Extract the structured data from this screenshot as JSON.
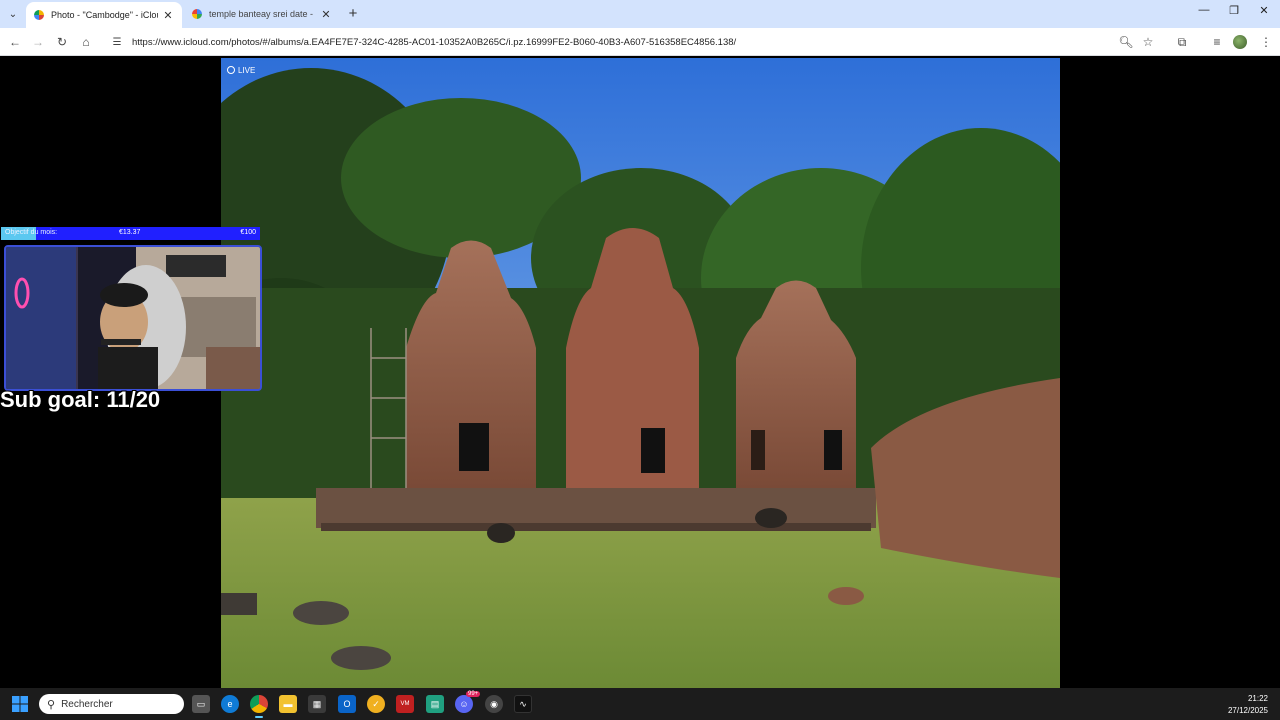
{
  "browser": {
    "tabs": [
      {
        "label": "Photo - \"Cambodge\" - iCloud P",
        "active": true
      },
      {
        "label": "temple banteay srei date - Rech",
        "active": false
      }
    ],
    "address_url": "https://www.icloud.com/photos/#/albums/a.EA4FE7E7-324C-4285-AC01-10352A0B265C/i.pz.16999FE2-B060-40B3-A607-516358EC4856.138/"
  },
  "photo": {
    "live_label": "LIVE"
  },
  "stream_overlay": {
    "goal_label": "Objectif du mois:",
    "goal_current": "€13.37",
    "goal_target": "€100",
    "goal_fraction": 0.1337,
    "sub_goal": "Sub goal: 11/20"
  },
  "taskbar": {
    "search_placeholder": "Rechercher",
    "time": "21:22",
    "date": "27/12/2025",
    "discord_badge": "99+"
  },
  "colors": {
    "tabstrip": "#d3e3fd",
    "goal_bar": "#2020ff",
    "goal_fill": "#5bc8f0",
    "taskbar": "#1c1c1c"
  }
}
